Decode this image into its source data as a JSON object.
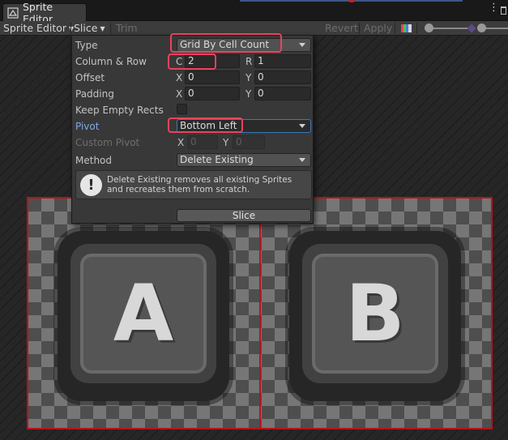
{
  "window": {
    "title": "Sprite Editor"
  },
  "toolbar": {
    "mode_label": "Sprite Editor",
    "slice_label": "Slice",
    "trim_label": "Trim",
    "revert_label": "Revert",
    "apply_label": "Apply"
  },
  "slice_panel": {
    "type": {
      "label": "Type",
      "value": "Grid By Cell Count"
    },
    "column_row": {
      "label": "Column & Row",
      "c_axis": "C",
      "c_value": "2",
      "r_axis": "R",
      "r_value": "1"
    },
    "offset": {
      "label": "Offset",
      "x_axis": "X",
      "x_value": "0",
      "y_axis": "Y",
      "y_value": "0"
    },
    "padding": {
      "label": "Padding",
      "x_axis": "X",
      "x_value": "0",
      "y_axis": "Y",
      "y_value": "0"
    },
    "keep_empty_rects": {
      "label": "Keep Empty Rects"
    },
    "pivot": {
      "label": "Pivot",
      "value": "Bottom Left"
    },
    "custom_pivot": {
      "label": "Custom Pivot",
      "x_axis": "X",
      "x_value": "0",
      "y_axis": "Y",
      "y_value": "0"
    },
    "method": {
      "label": "Method",
      "value": "Delete Existing"
    },
    "help_text": "Delete Existing removes all existing Sprites and recreates them from scratch.",
    "slice_button": "Slice"
  },
  "sprite": {
    "key_a": "A",
    "key_b": "B"
  },
  "colors": {
    "highlight": "#e8435d",
    "slice_lines": "#b6141c",
    "pivot_label": "#7ea8e6"
  },
  "icons": [
    "sprite-editor-icon",
    "kebab-menu-icon",
    "maximize-icon",
    "color-channel-icon",
    "info-icon",
    "dropdown-arrow-icon"
  ]
}
